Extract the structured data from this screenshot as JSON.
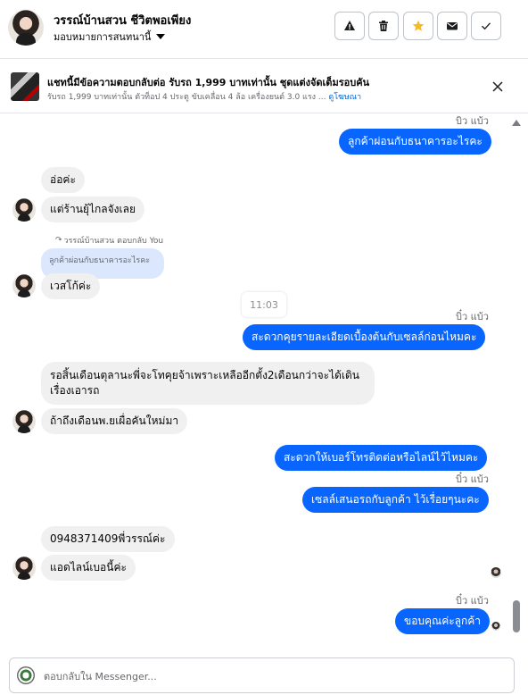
{
  "header": {
    "contact_name": "วรรณ์บ้านสวน ชีวิตพอเพียง",
    "assign_label": "มอบหมายการสนทนานี้",
    "actions": [
      {
        "name": "report-button",
        "icon": "warning-icon"
      },
      {
        "name": "delete-button",
        "icon": "trash-icon"
      },
      {
        "name": "star-button",
        "icon": "star-icon"
      },
      {
        "name": "mark-unread-button",
        "icon": "envelope-icon"
      },
      {
        "name": "mark-done-button",
        "icon": "check-icon"
      }
    ]
  },
  "ad": {
    "title": "แชทนี้มีข้อความตอบกลับต่อ รับรถ 1,999 บาทเท่านั้น ชุดแต่งจัดเต็มรอบคัน",
    "description": "รับรถ 1,999 บาทเท่านั้น ตัวท็อป 4 ประตู ขับเคลื่อน 4 ล้อ เครื่องยนต์ 3.0 แรง ...",
    "link": "ดูโฆษณา"
  },
  "messages": {
    "m1_sender": "บิว แบ้ว",
    "m1": "ลูกค้าผ่อนกับธนาคารอะไรคะ",
    "m2": "อ่อค่ะ",
    "m3": "แต่ร้านยุ้ไกลจังเลย",
    "reply_label": "วรรณ์บ้านสวน ตอบกลับ You",
    "reply_quote": "ลูกค้าผ่อนกับธนาคารอะไรคะ",
    "m4": "เวสโก้ค่ะ",
    "time_chip": "11:03",
    "m5_sender": "บิ๋ว แบ้ว",
    "m5": "สะดวกคุยรายละเอียดเบื้องต้นกับเซลล์ก่อนไหมคะ",
    "m6_line1": "รอสิ้นเดือนตุลานะพี่จะโทคุยจ้าเพราะเหลืออีกตั้ง2เดือนกว่าจะได้เดิน",
    "m6_line2": "เรื่องเอารถ",
    "m7": "ถ้าถึงเดือนพ.ยเผื่อคันใหม่มา",
    "m8": "สะดวกให้เบอร์โทรติดต่อหรือไลน์ไว้ไหมคะ",
    "m9_sender": "บิ๋ว แบ้ว",
    "m9": "เซลล์เสนอรถกับลูกค้า ไว้เรื่อยๆนะคะ",
    "m10": "0948371409พี่วรรณ์ค่ะ",
    "m11": "แอดไลน์เบอนี้ค่ะ",
    "m12_sender": "บิ๋ว แบ้ว",
    "m12": "ขอบคุณค่ะลูกค้า"
  },
  "composer": {
    "placeholder": "ตอบกลับใน Messenger..."
  },
  "colors": {
    "outgoing_bubble": "#0866ff",
    "incoming_bubble": "#f0f0f0",
    "reply_quote_bubble": "#dbe7fd",
    "star_accent": "#f7b928",
    "link": "#0064d1"
  }
}
